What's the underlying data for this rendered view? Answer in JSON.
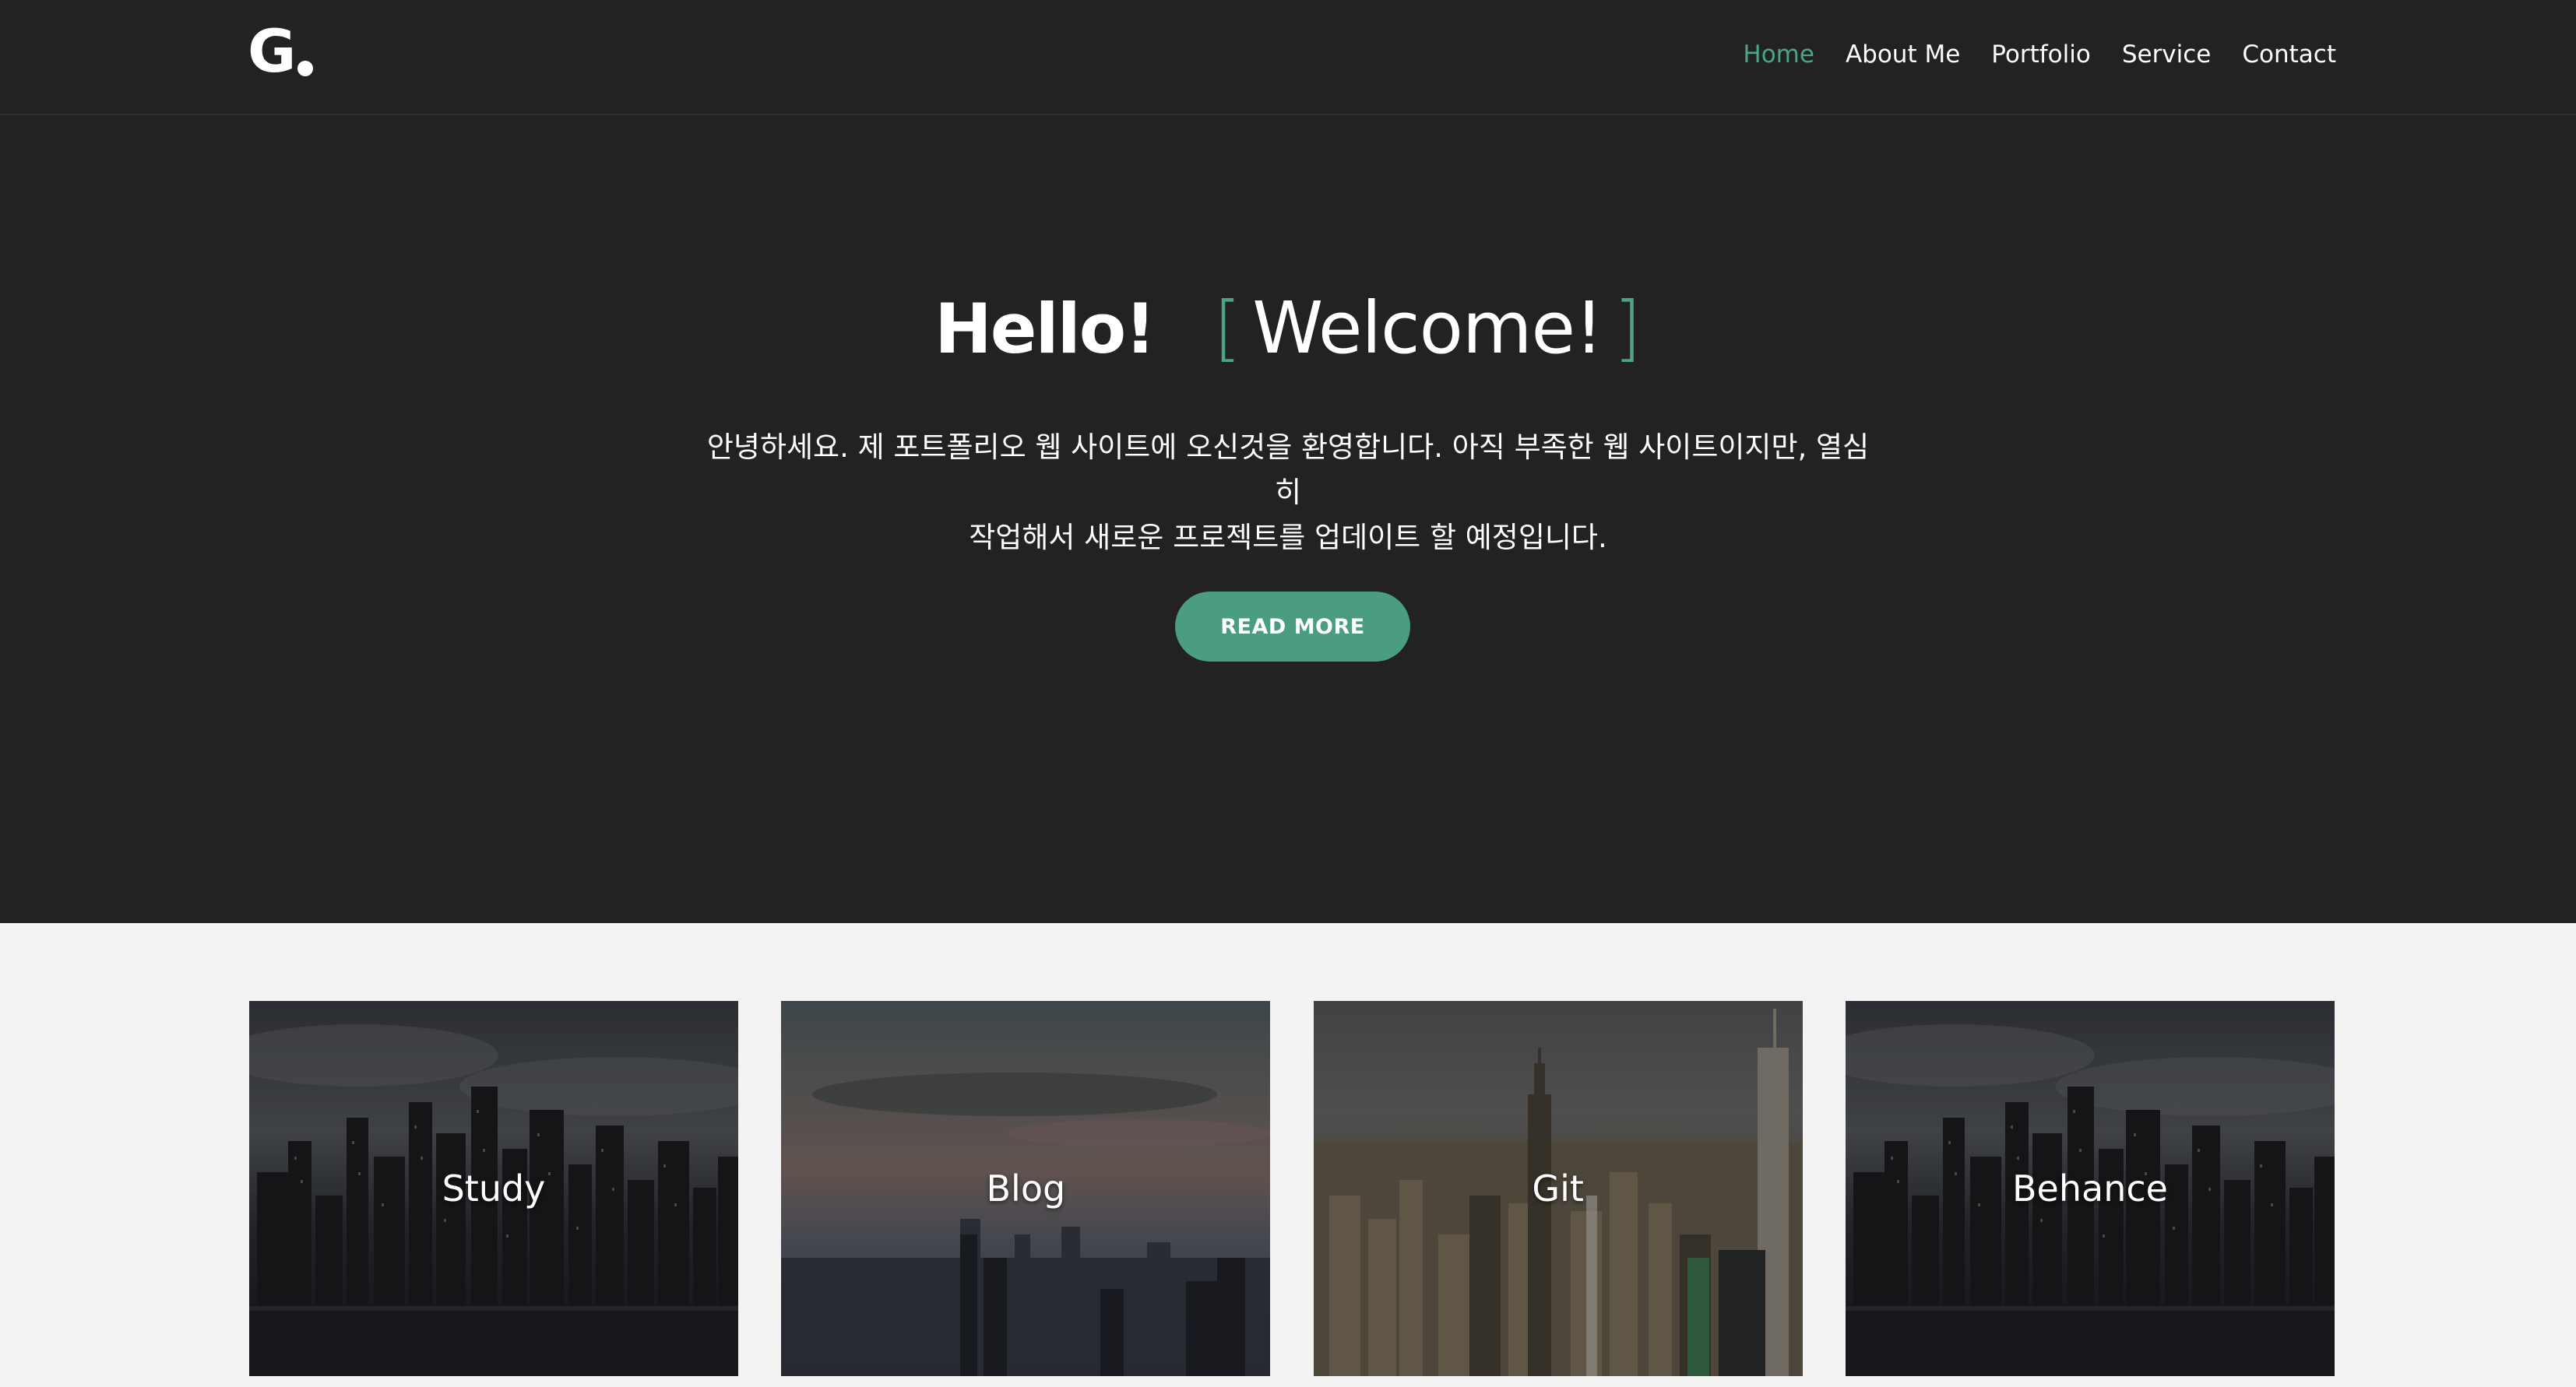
{
  "header": {
    "logo_letter": "G",
    "nav": [
      {
        "label": "Home",
        "active": true
      },
      {
        "label": "About Me",
        "active": false
      },
      {
        "label": "Portfolio",
        "active": false
      },
      {
        "label": "Service",
        "active": false
      },
      {
        "label": "Contact",
        "active": false
      }
    ]
  },
  "hero": {
    "hello": "Hello!",
    "bracket_open": "[",
    "welcome": "Welcome!",
    "bracket_close": "]",
    "description_line1": "안녕하세요. 제 포트폴리오 웹 사이트에 오신것을 환영합니다. 아직 부족한 웹 사이트이지만, 열심히",
    "description_line2": "작업해서 새로운 프로젝트를 업데이트 할 예정입니다.",
    "button_label": "READ MORE"
  },
  "cards": [
    {
      "label": "Study",
      "icon": "city-skyline-night-image"
    },
    {
      "label": "Blog",
      "icon": "city-sunset-image"
    },
    {
      "label": "Git",
      "icon": "city-empire-state-image"
    },
    {
      "label": "Behance",
      "icon": "city-skyline-night-image"
    }
  ],
  "colors": {
    "accent": "#4aa585",
    "button": "#4a9d82",
    "dark_bg": "#222222",
    "light_bg": "#f3f3f3"
  }
}
